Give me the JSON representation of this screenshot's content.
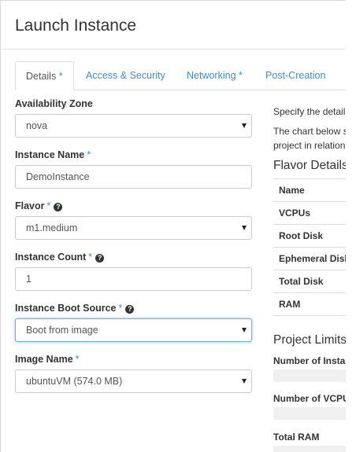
{
  "modal": {
    "title": "Launch Instance"
  },
  "tabs": [
    {
      "label": "Details",
      "required": "*"
    },
    {
      "label": "Access & Security"
    },
    {
      "label": "Networking",
      "required": "*"
    },
    {
      "label": "Post-Creation"
    }
  ],
  "form": {
    "availability_zone": {
      "label": "Availability Zone",
      "value": "nova"
    },
    "instance_name": {
      "label": "Instance Name",
      "required": "*",
      "value": "DemoInstance"
    },
    "flavor": {
      "label": "Flavor",
      "required": "*",
      "help": "?",
      "value": "m1.medium"
    },
    "instance_count": {
      "label": "Instance Count",
      "required": "*",
      "help": "?",
      "value": "1"
    },
    "boot_source": {
      "label": "Instance Boot Source",
      "required": "*",
      "help": "?",
      "value": "Boot from image"
    },
    "image_name": {
      "label": "Image Name",
      "required": "*",
      "value": "ubuntuVM (574.0 MB)"
    }
  },
  "side_panel": {
    "intro_text": "Specify the detail",
    "chart_text_line1": "The chart below s",
    "chart_text_line2": "project in relation",
    "flavor_details_heading": "Flavor Details",
    "flavor_rows": [
      "Name",
      "VCPUs",
      "Root Disk",
      "Ephemeral Disk",
      "Total Disk",
      "RAM"
    ],
    "project_limits_heading": "Project Limits",
    "limits": [
      {
        "label": "Number of Instances"
      },
      {
        "label": "Number of VCPUs"
      },
      {
        "label": "Total RAM"
      }
    ]
  },
  "colors": {
    "link": "#428bca",
    "focus_border": "#66afe9",
    "border": "#cccccc"
  }
}
